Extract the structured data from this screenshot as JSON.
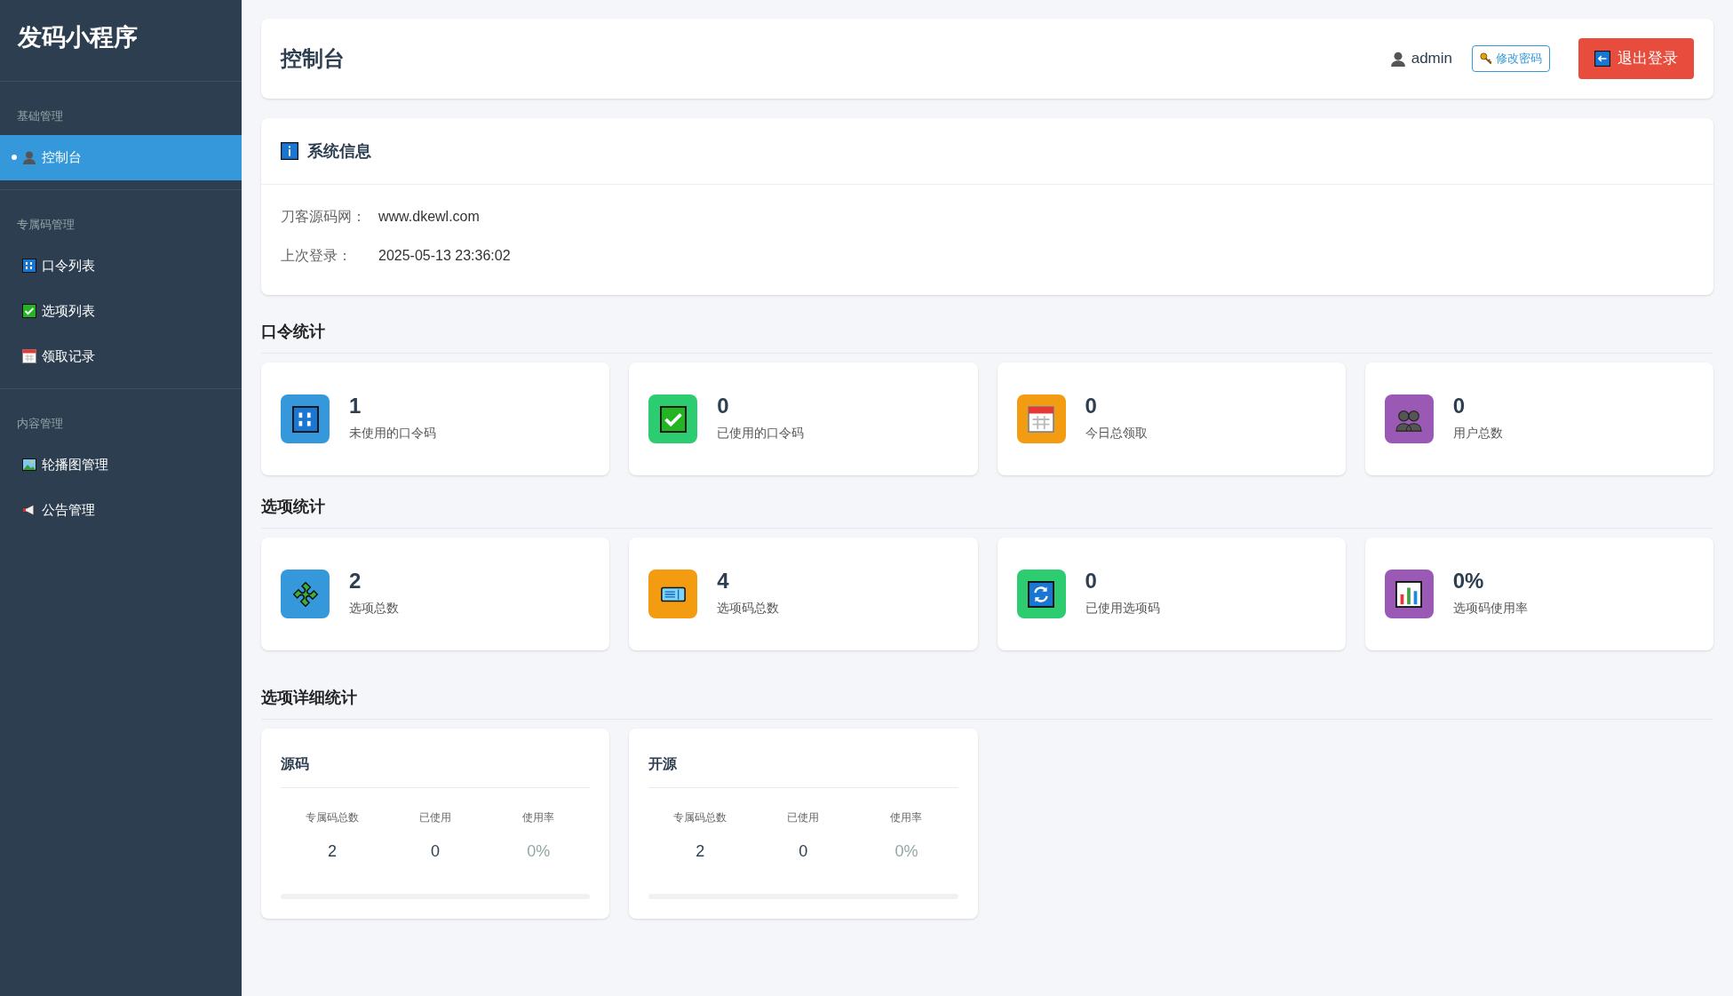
{
  "sidebar": {
    "title": "发码小程序",
    "groups": [
      {
        "label": "基础管理",
        "items": [
          {
            "label": "控制台",
            "selected": true
          }
        ]
      },
      {
        "label": "专属码管理",
        "items": [
          {
            "label": "口令列表",
            "selected": false
          },
          {
            "label": "选项列表",
            "selected": false
          },
          {
            "label": "领取记录",
            "selected": false
          }
        ]
      },
      {
        "label": "内容管理",
        "items": [
          {
            "label": "轮播图管理",
            "selected": false
          },
          {
            "label": "公告管理",
            "selected": false
          }
        ]
      }
    ]
  },
  "header": {
    "title": "控制台",
    "user": "admin",
    "change_password": "修改密码",
    "logout": "退出登录"
  },
  "system_info": {
    "title": "系统信息",
    "rows": [
      {
        "label": "刀客源码网：",
        "value": "www.dkewl.com"
      },
      {
        "label": "上次登录：",
        "value": "2025-05-13 23:36:02"
      }
    ]
  },
  "sections": [
    {
      "title": "口令统计",
      "cards": [
        {
          "value": "1",
          "label": "未使用的口令码",
          "color": "#3498db"
        },
        {
          "value": "0",
          "label": "已使用的口令码",
          "color": "#2ecc71"
        },
        {
          "value": "0",
          "label": "今日总领取",
          "color": "#f39c12"
        },
        {
          "value": "0",
          "label": "用户总数",
          "color": "#9b59b6"
        }
      ]
    },
    {
      "title": "选项统计",
      "cards": [
        {
          "value": "2",
          "label": "选项总数",
          "color": "#3498db"
        },
        {
          "value": "4",
          "label": "选项码总数",
          "color": "#f39c12"
        },
        {
          "value": "0",
          "label": "已使用选项码",
          "color": "#2ecc71"
        },
        {
          "value": "0%",
          "label": "选项码使用率",
          "color": "#9b59b6"
        }
      ]
    }
  ],
  "detail": {
    "title": "选项详细统计",
    "cards": [
      {
        "title": "源码",
        "columns": [
          "专属码总数",
          "已使用",
          "使用率"
        ],
        "values": [
          "2",
          "0",
          "0%"
        ],
        "level": 0
      },
      {
        "title": "开源",
        "columns": [
          "专属码总数",
          "已使用",
          "使用率"
        ],
        "values": [
          "2",
          "0",
          "0%"
        ],
        "level": 0
      }
    ]
  }
}
